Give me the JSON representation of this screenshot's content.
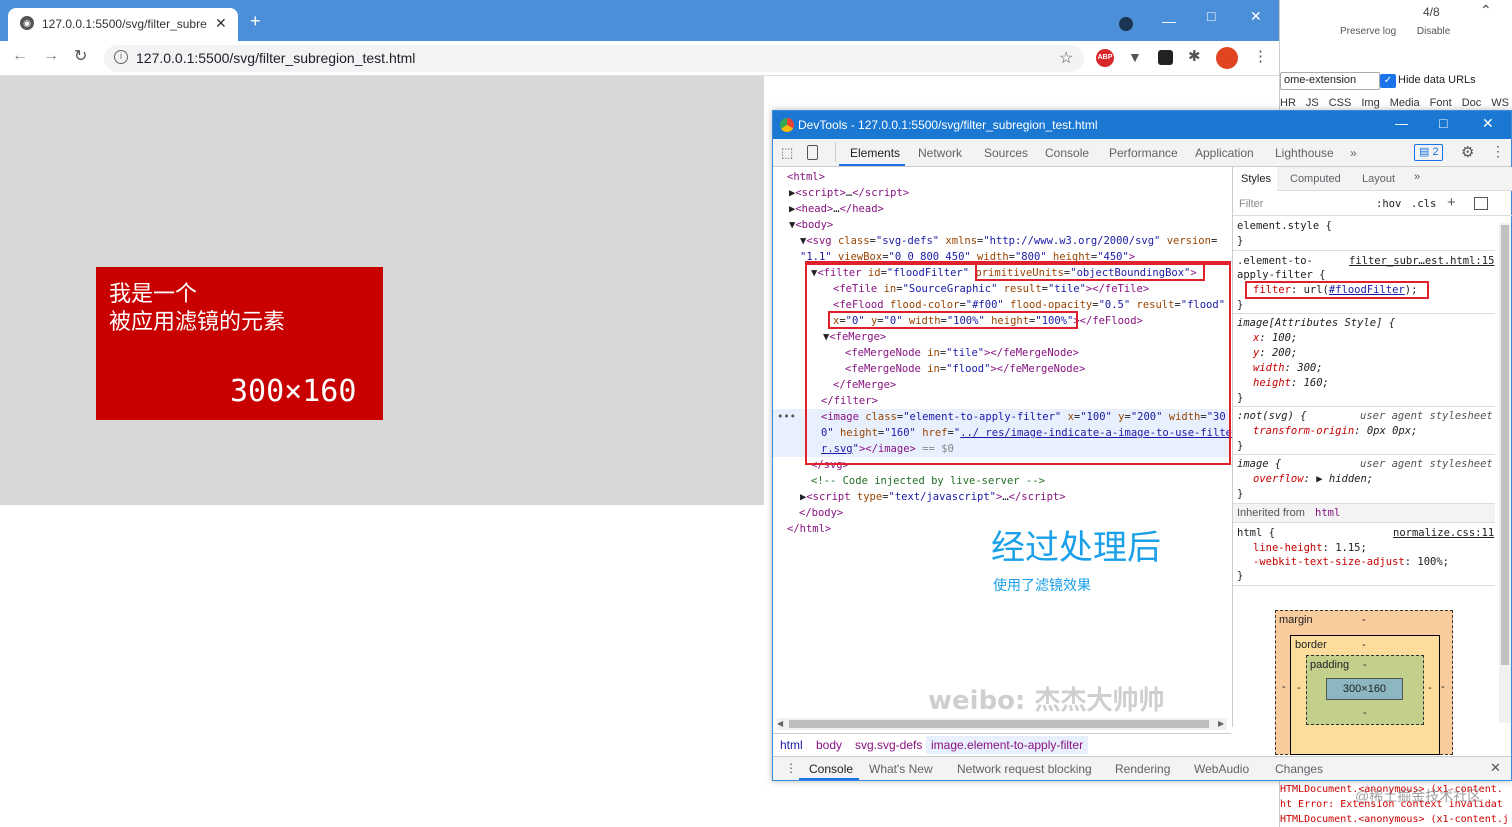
{
  "bg_devtools": {
    "counter": "4/8",
    "preserve_log": "Preserve log",
    "disable_cache": "Disable",
    "filter_value": "ome-extension",
    "hide_data_urls": "Hide data URLs",
    "type_filters": [
      "HR",
      "JS",
      "CSS",
      "Img",
      "Media",
      "Font",
      "Doc",
      "WS"
    ],
    "console_lines": [
      "HTMLDocument.<anonymous> (x1-content.",
      "ht Error: Extension context invalidat",
      "HTMLDocument.<anonymous> (x1-content.j"
    ],
    "watermark2": "@稀土掘金技术社区"
  },
  "browser": {
    "tab_title": "127.0.0.1:5500/svg/filter_subre",
    "url": "127.0.0.1:5500/svg/filter_subregion_test.html",
    "content": {
      "line1": "我是一个",
      "line2": "被应用滤镜的元素",
      "size": "300×160"
    }
  },
  "devtools": {
    "title": "DevTools - 127.0.0.1:5500/svg/filter_subregion_test.html",
    "tabs": [
      "Elements",
      "Network",
      "Sources",
      "Console",
      "Performance",
      "Application",
      "Lighthouse"
    ],
    "badge": "2",
    "breadcrumbs": [
      "html",
      "body",
      "svg.svg-defs",
      "image.element-to-apply-filter"
    ],
    "drawer_tabs": [
      "Console",
      "What's New",
      "Network request blocking",
      "Rendering",
      "WebAudio",
      "Changes"
    ],
    "overlay_title": "经过处理后",
    "overlay_sub": "使用了滤镜效果",
    "watermark": "weibo: 杰杰大帅帅",
    "styles": {
      "subtabs": [
        "Styles",
        "Computed",
        "Layout"
      ],
      "filter_placeholder": "Filter",
      "hov": ":hov",
      "cls": ".cls",
      "element_style": "element.style {",
      "rule1_selector_a": ".element-to-",
      "rule1_selector_b": "apply-filter {",
      "rule1_source": "filter_subr…est.html:15",
      "rule1_prop": "filter",
      "rule1_val_pre": "url(",
      "rule1_val_link": "#floodFilter",
      "rule1_val_post": ");",
      "attr_selector": "image[Attributes Style] {",
      "attr_props": [
        [
          "x",
          "100;"
        ],
        [
          "y",
          "200;"
        ],
        [
          "width",
          "300;"
        ],
        [
          "height",
          "160;"
        ]
      ],
      "notsvg_selector": ":not(svg) {",
      "ua": "user agent stylesheet",
      "notsvg_prop": "transform-origin",
      "notsvg_val": "0px 0px;",
      "image_selector": "image {",
      "image_prop": "overflow",
      "image_val": "hidden;",
      "inherited": "Inherited from",
      "inherited_tag": "html",
      "html_selector": "html {",
      "html_source": "normalize.css:11",
      "html_props": [
        [
          "line-height",
          "1.15;"
        ],
        [
          "-webkit-text-size-adjust",
          "100%;"
        ]
      ],
      "box": {
        "margin": "margin",
        "border": "border",
        "padding": "padding",
        "content": "300×160",
        "dash": "-"
      }
    }
  }
}
